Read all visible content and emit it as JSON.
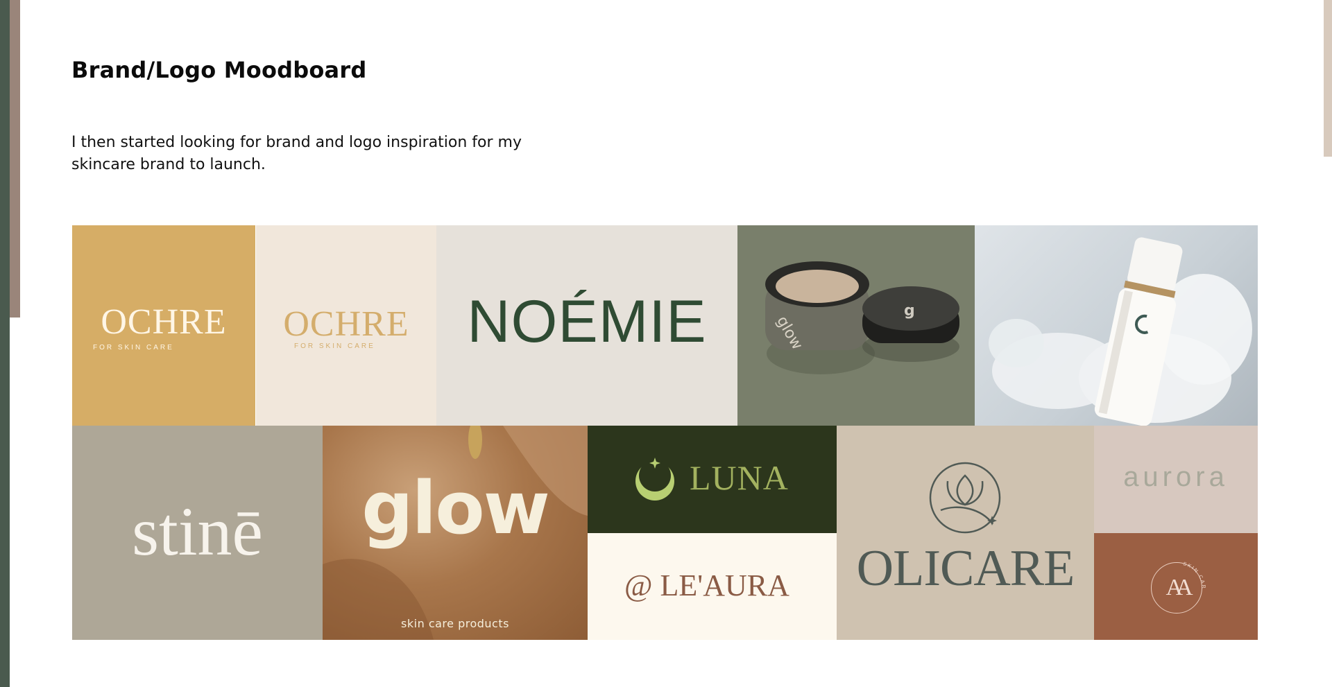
{
  "page": {
    "title": "Brand/Logo Moodboard",
    "intro": "I then started looking for brand and logo inspiration for my skincare brand to launch."
  },
  "moodboard": {
    "tiles": [
      {
        "name": "ochre-gold",
        "wordmark": "OCHRE",
        "tagline": "FOR SKIN CARE",
        "background": "#d6ad66",
        "text_color": "#fff6e6"
      },
      {
        "name": "ochre-cream",
        "wordmark": "OCHRE",
        "tagline": "FOR SKIN CARE",
        "background": "#f1e7db",
        "text_color": "#d4ad6c"
      },
      {
        "name": "noemie",
        "wordmark": "NOÉMIE",
        "background": "#e6e1da",
        "text_color": "#2f4b33"
      },
      {
        "name": "glow-jars",
        "image": "skincare jars with lids",
        "background": "#797f6b"
      },
      {
        "name": "bottle-foam",
        "image": "white serum bottle with foam",
        "background": "#c8d0d6"
      },
      {
        "name": "stine",
        "wordmark": "stinē",
        "background": "#aea797",
        "text_color": "#f7f3ec"
      },
      {
        "name": "glow-photo",
        "wordmark": "glow",
        "tagline": "skin care products",
        "background": "#a8764b",
        "text_color": "#f6efdc"
      },
      {
        "name": "luna",
        "wordmark": "LUNA",
        "icon": "crescent-moon-icon",
        "background": "#2c361c",
        "text_color": "#a3b25f"
      },
      {
        "name": "leaura",
        "wordmark": "@ LE'AURA",
        "background": "#fdf8ee",
        "text_color": "#8a5b45"
      },
      {
        "name": "olicare",
        "wordmark": "OLICARE",
        "icon": "lotus-circle-icon",
        "background": "#cfc2b0",
        "text_color": "#505a55"
      },
      {
        "name": "aurora",
        "wordmark": "aurora",
        "background": "#d7c8bf",
        "text_color": "#a8a89a"
      },
      {
        "name": "aa-monogram",
        "wordmark": "AA",
        "tagline": "SKIN CARE",
        "background": "#9b5f43",
        "text_color": "#f2ddd2"
      }
    ]
  }
}
